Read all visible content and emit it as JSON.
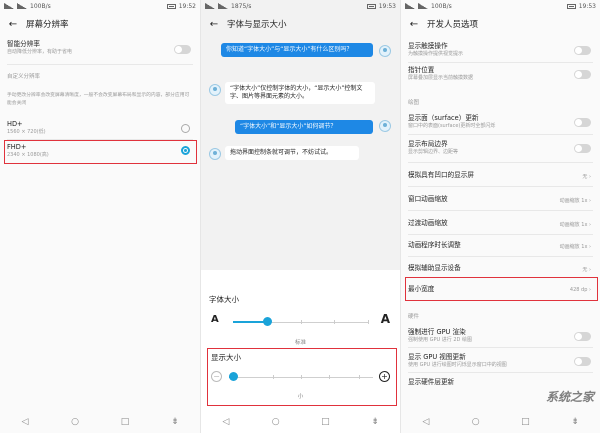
{
  "status": {
    "p1": {
      "speed": "100B/s",
      "time": "19:52"
    },
    "p2": {
      "speed": "1875/s",
      "time": "19:53"
    },
    "p3": {
      "speed": "100B/s",
      "time": "19:53"
    }
  },
  "panel1": {
    "title": "屏幕分辨率",
    "smart": {
      "label": "智能分辨率",
      "desc": "自动降低分辨率，有助于省电"
    },
    "custom_section": "自定义分辨率",
    "custom_desc": "手动更改分辨率会改变屏幕清晰度，一般不会改变屏幕布局和显示的内容，部分应用可能会关闭",
    "options": [
      {
        "label": "HD+",
        "value": "1560 × 720(低)",
        "selected": false
      },
      {
        "label": "FHD+",
        "value": "2340 × 1080(高)",
        "selected": true
      }
    ]
  },
  "panel2": {
    "title": "字体与显示大小",
    "messages": [
      {
        "side": "right",
        "text": "你知道“字体大小”与“显示大小”有什么区别吗？"
      },
      {
        "side": "left",
        "text": "“字体大小”仅控制字体的大小，“显示大小”控制文字、图片等界面元素的大小。"
      },
      {
        "side": "right",
        "text": "“字体大小”和“显示大小”如何调节？"
      },
      {
        "side": "left",
        "text": "拖动界面控制条就可调节，不妨试试。"
      }
    ],
    "font_size_label": "字体大小",
    "font_small_glyph": "A",
    "font_large_glyph": "A",
    "font_size_value": "标准",
    "display_size_label": "显示大小",
    "display_size_value": "小",
    "minus_glyph": "−",
    "plus_glyph": "+",
    "page_dot": "•"
  },
  "panel3": {
    "title": "开发人员选项",
    "items": [
      {
        "label": "显示触摸操作",
        "desc": "为触摸操作提供视觉提示",
        "control": "toggle"
      },
      {
        "label": "指针位置",
        "desc": "屏幕叠加层显示当前触摸数据",
        "control": "toggle"
      }
    ],
    "section_draw": "绘图",
    "draw_items": [
      {
        "label": "显示面（surface）更新",
        "desc": "窗口中的表面(surface)更新时全部闪烁",
        "control": "toggle"
      },
      {
        "label": "显示布局边界",
        "desc": "显示剪辑边界、边距等",
        "control": "toggle"
      },
      {
        "label": "模拟具有凹口的显示屏",
        "value": "无"
      },
      {
        "label": "窗口动画缩放",
        "value": "动画缩放 1x"
      },
      {
        "label": "过渡动画缩放",
        "value": "动画缩放 1x"
      },
      {
        "label": "动画程序时长调整",
        "value": "动画缩放 1x"
      },
      {
        "label": "模拟辅助显示设备",
        "value": "无"
      },
      {
        "label": "最小宽度",
        "value": "428 dp"
      }
    ],
    "section_hw": "硬件",
    "hw_items": [
      {
        "label": "强制进行 GPU 渲染",
        "desc": "强制使用 GPU 进行 2D 绘图",
        "control": "toggle"
      },
      {
        "label": "显示 GPU 视图更新",
        "desc": "使用 GPU 进行绘图时闪烁显示窗口中的视图",
        "control": "toggle"
      },
      {
        "label": "显示硬件层更新"
      }
    ]
  },
  "nav": {
    "back": "◁",
    "home": "○",
    "recent": "□",
    "menu": "⇟"
  },
  "watermark": "系统之家",
  "colors": {
    "accent": "#1aa3d9",
    "highlight": "#e0323c",
    "bubble_blue": "#1e88e5"
  }
}
